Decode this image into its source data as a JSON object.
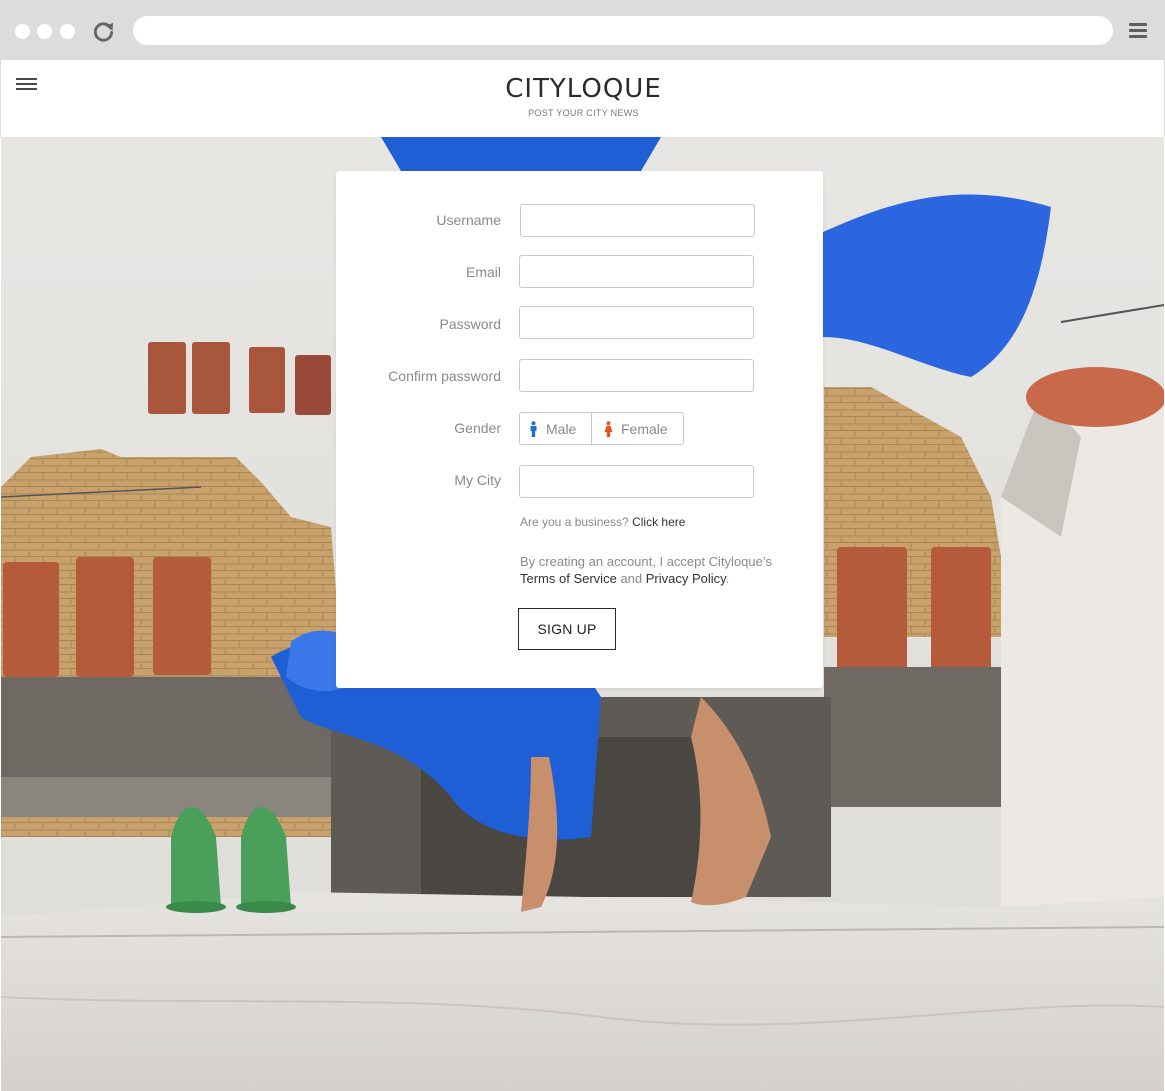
{
  "browser": {
    "url": "",
    "buttons": [
      "close",
      "minimize",
      "maximize"
    ]
  },
  "header": {
    "logo": "CITYLOQUE",
    "tagline": "POST YOUR CITY NEWS"
  },
  "form": {
    "username_label": "Username",
    "email_label": "Email",
    "password_label": "Password",
    "confirm_password_label": "Confirm password",
    "gender_label": "Gender",
    "gender_male": "Male",
    "gender_female": "Female",
    "city_label": "My City",
    "business_prompt": "Are you a business?",
    "business_link": "Click here",
    "terms_prefix": "By creating an account, I accept Cityloque’s",
    "terms_link": "Terms of Service",
    "terms_and": "and",
    "privacy_link": "Privacy Policy",
    "terms_suffix": ".",
    "signup_button": "SIGN UP"
  },
  "colors": {
    "male_icon": "#1a73c9",
    "female_icon": "#e8521c",
    "dress_blue": "#1f5fd6",
    "brick": "#c7a06a",
    "chimney_pot": "#b55a3a"
  },
  "icons": {
    "reload": "reload-icon",
    "browser_menu": "menu-icon",
    "site_menu": "hamburger-icon",
    "male": "male-icon",
    "female": "female-icon"
  }
}
